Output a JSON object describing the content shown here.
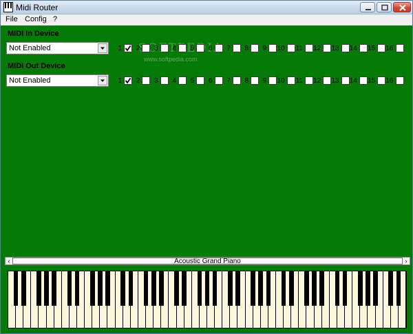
{
  "window": {
    "title": "Midi Router"
  },
  "menu": [
    "File",
    "Config",
    "?"
  ],
  "midi_in": {
    "label": "MIDI In Device",
    "value": "Not Enabled"
  },
  "midi_out": {
    "label": "MIDI Out Device",
    "value": "Not Enabled"
  },
  "channels": [
    "1",
    "2",
    "3",
    "4",
    "5",
    "6",
    "7",
    "8",
    "9",
    "10",
    "11",
    "12",
    "13",
    "14",
    "15",
    "16"
  ],
  "midi_in_checked": [
    true,
    false,
    false,
    false,
    false,
    false,
    false,
    false,
    false,
    false,
    false,
    false,
    false,
    false,
    false,
    false
  ],
  "midi_out_checked": [
    true,
    false,
    false,
    false,
    false,
    false,
    false,
    false,
    false,
    false,
    false,
    false,
    false,
    false,
    false,
    false
  ],
  "watermark": {
    "text": "SOFTPEDIA",
    "url": "www.softpedia.com"
  },
  "instrument": {
    "name": "Acoustic Grand Piano"
  },
  "colors": {
    "background": "#057a07",
    "piano_white": "#fbf7dd"
  }
}
